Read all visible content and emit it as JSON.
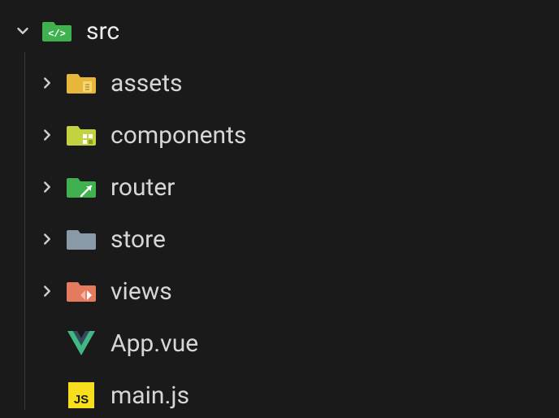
{
  "tree": {
    "root": {
      "label": "src",
      "expanded": true,
      "icon": "src-folder-icon"
    },
    "children": [
      {
        "label": "assets",
        "type": "folder",
        "icon": "assets-folder-icon",
        "expanded": false
      },
      {
        "label": "components",
        "type": "folder",
        "icon": "components-folder-icon",
        "expanded": false
      },
      {
        "label": "router",
        "type": "folder",
        "icon": "router-folder-icon",
        "expanded": false
      },
      {
        "label": "store",
        "type": "folder",
        "icon": "store-folder-icon",
        "expanded": false
      },
      {
        "label": "views",
        "type": "folder",
        "icon": "views-folder-icon",
        "expanded": false
      },
      {
        "label": "App.vue",
        "type": "file",
        "icon": "vue-file-icon"
      },
      {
        "label": "main.js",
        "type": "file",
        "icon": "js-file-icon"
      }
    ]
  },
  "colors": {
    "src_green": "#3fb24f",
    "assets_yellow": "#e8b63a",
    "components_olive": "#c3d33f",
    "router_green": "#3fb24f",
    "store_gray": "#8a99a8",
    "views_coral": "#e47a5e",
    "vue_dark": "#35495e",
    "vue_green": "#41b883",
    "js_bg": "#f7df1e",
    "js_fg": "#1a1a1a"
  }
}
